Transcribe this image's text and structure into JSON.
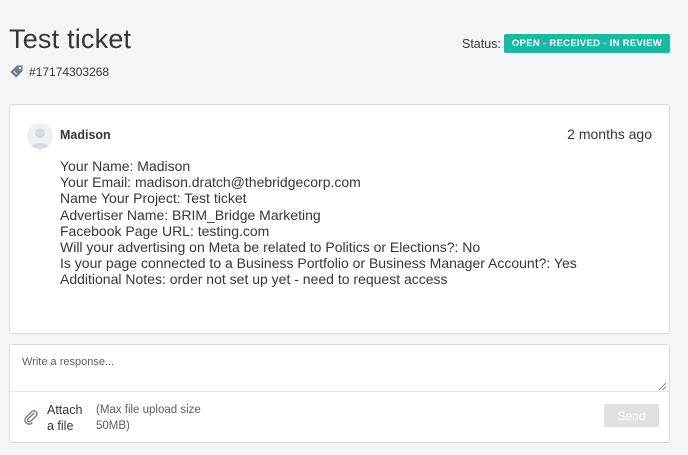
{
  "header": {
    "title": "Test ticket",
    "ticket_id": "#17174303268",
    "status_label": "Status:",
    "status_value": "OPEN - RECEIVED - IN REVIEW",
    "status_color": "#19b9a6"
  },
  "message": {
    "author": "Madison",
    "time": "2 months ago",
    "lines": [
      "Your Name: Madison",
      "Your Email: madison.dratch@thebridgecorp.com",
      "Name Your Project: Test ticket",
      "Advertiser Name: BRIM_Bridge Marketing",
      "Facebook Page URL: testing.com",
      "Will your advertising on Meta be related to Politics or Elections?: No",
      "Is your page connected to a Business Portfolio or Business Manager Account?: Yes",
      "Additional Notes: order not set up yet - need to request access"
    ]
  },
  "reply": {
    "placeholder": "Write a response...",
    "attach_label": "Attach a file",
    "attach_note": "(Max file upload size 50MB)",
    "send_label": "Send"
  },
  "icons": {
    "ticket": "tag-icon",
    "avatar": "user-avatar-icon",
    "attach": "paperclip-icon"
  }
}
